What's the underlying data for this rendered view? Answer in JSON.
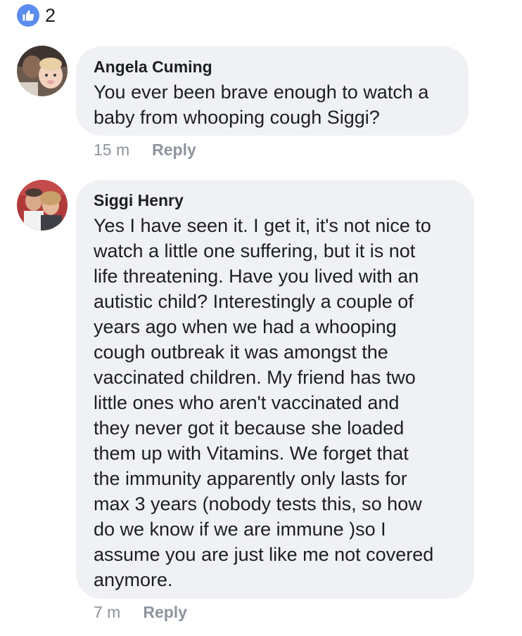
{
  "reactions": {
    "like_icon": "thumbs-up-icon",
    "like_color": "#5b8cf0",
    "count": "2"
  },
  "comments": [
    {
      "author": "Angela Cuming",
      "text": "You ever been brave enough to watch a\nbaby from whooping cough Siggi?",
      "time": "15 m",
      "reply_label": "Reply"
    },
    {
      "author": "Siggi Henry",
      "text": "Yes I have seen it. I get it, it's not nice to\nwatch a little one suffering, but it is not\nlife threatening. Have you lived with an\nautistic child? Interestingly a couple of\nyears ago when we had a whooping\ncough outbreak it was amongst the\nvaccinated children. My friend has two\nlittle ones who aren't vaccinated and\nthey never got it because she loaded\nthem up with Vitamins. We forget that\nthe immunity apparently only lasts for\nmax 3 years (nobody tests this, so how\ndo we know if we are immune )so I\nassume you are just like me not covered\nanymore.",
      "time": "7 m",
      "reply_label": "Reply"
    }
  ]
}
